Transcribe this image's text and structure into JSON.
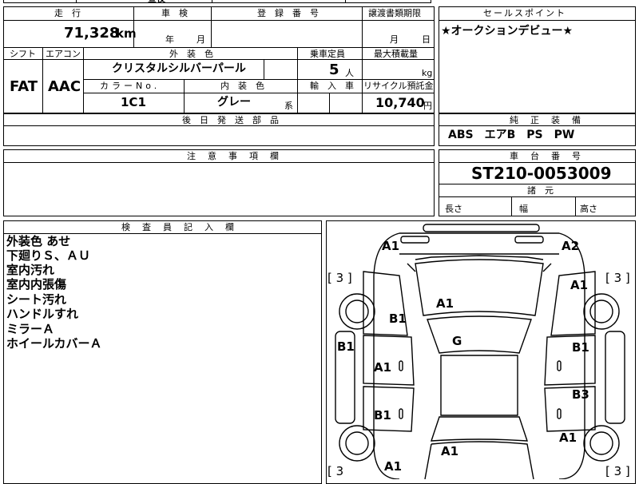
{
  "header_strip": {
    "partial_text": "昼夜"
  },
  "mileage": {
    "label": "走　行",
    "value": "71,328",
    "unit": "km"
  },
  "inspection": {
    "label": "車　検",
    "year_unit": "年",
    "month_unit": "月"
  },
  "registration": {
    "label": "登　録　番　号"
  },
  "transfer_docs": {
    "label": "譲渡書類期限",
    "month_unit": "月",
    "day_unit": "日"
  },
  "sales_point": {
    "label": "セールスポイント",
    "text": "★オークションデビュー★"
  },
  "shift": {
    "label": "シフト",
    "value": "FAT"
  },
  "aircon": {
    "label": "エアコン",
    "value": "AAC"
  },
  "exterior_color": {
    "label": "外　装　色",
    "value": "クリスタルシルバーパール"
  },
  "capacity": {
    "label": "乗車定員",
    "value": "5",
    "unit": "人"
  },
  "max_load": {
    "label": "最大積載量",
    "unit": "kg"
  },
  "color_no": {
    "label": "カラーNo.",
    "value": "1C1"
  },
  "interior_color": {
    "label": "内　装　色",
    "value": "グレー",
    "suffix": "系"
  },
  "import": {
    "label": "輸　入　車"
  },
  "recycle": {
    "label": "リサイクル預託金",
    "value": "10,740",
    "unit": "円"
  },
  "later_parts": {
    "label": "後　日　発　送　部　品"
  },
  "genuine_equipment": {
    "label": "純　正　装　備",
    "value": "ABS　エアB　PS　PW"
  },
  "notes": {
    "label": "注　意　事　項　欄"
  },
  "chassis": {
    "label": "車　台　番　号",
    "value": "ST210-0053009"
  },
  "dimensions": {
    "label": "諸　元",
    "length": "長さ",
    "width": "幅",
    "height": "高さ"
  },
  "inspector": {
    "label": "検　査　員　記　入　欄",
    "lines": [
      "外装色 あせ",
      "下廻りＳ、ＡＵ",
      "室内汚れ",
      "室内内張傷",
      "シート汚れ",
      "ハンドルすれ",
      "ミラーＡ",
      "ホイールカバーＡ"
    ]
  },
  "diagram_marks": {
    "front_left_corner": "A1",
    "front_right_corner": "A2",
    "left_fender": "B1",
    "bonnet": "A1",
    "right_fender": "A1",
    "left_front_door": "A1",
    "roof": "G",
    "right_front_door": "B1",
    "left_rear_door": "B1",
    "right_rear_door": "B3",
    "trunk": "A1",
    "right_quarter": "A1",
    "left_rear_corner": "A1",
    "left_side": "B1",
    "tyre_front_left": "[ 3 ]",
    "tyre_front_right": "[ 3 ]",
    "tyre_rear_left": "[ 3",
    "tyre_rear_right": "[ 3 ]"
  }
}
